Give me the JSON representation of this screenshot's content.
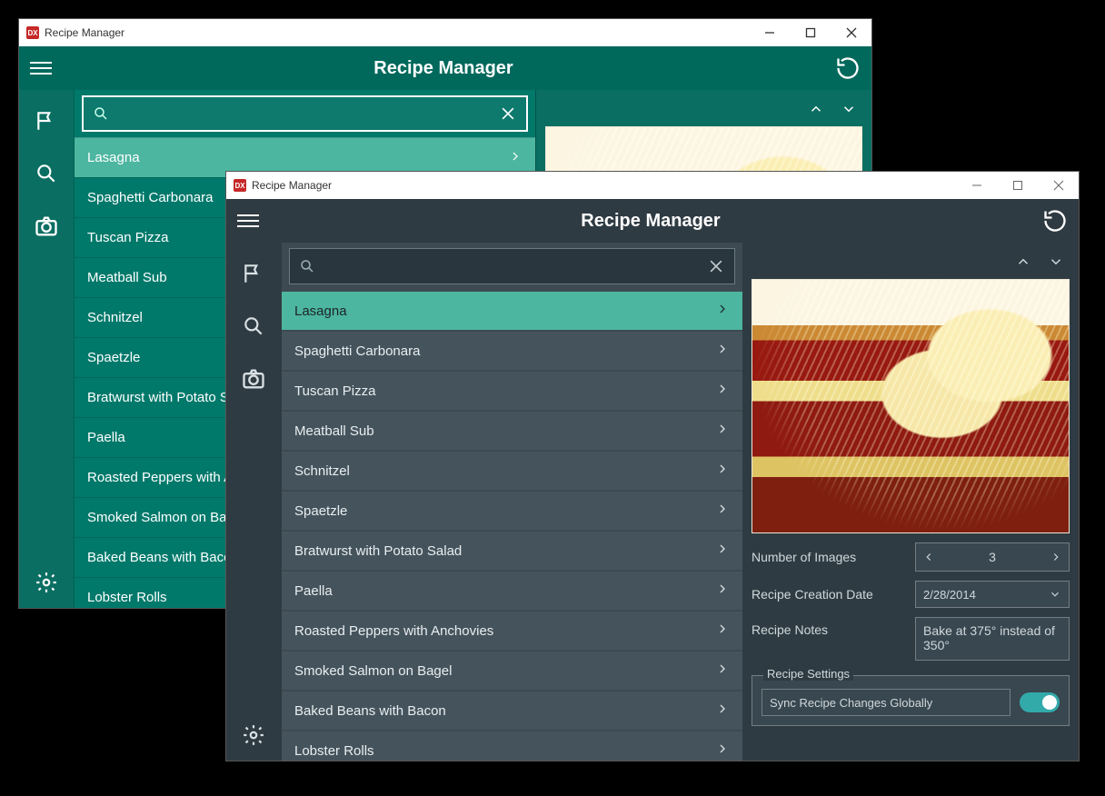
{
  "windows": {
    "teal": {
      "title": "Recipe Manager",
      "app_title": "Recipe Manager"
    },
    "dark": {
      "title": "Recipe Manager",
      "app_title": "Recipe Manager"
    }
  },
  "search": {
    "placeholder": ""
  },
  "recipes": [
    "Lasagna",
    "Spaghetti Carbonara",
    "Tuscan Pizza",
    "Meatball Sub",
    "Schnitzel",
    "Spaetzle",
    "Bratwurst with Potato Salad",
    "Paella",
    "Roasted Peppers with Anchovies",
    "Smoked Salmon on Bagel",
    "Baked Beans with Bacon",
    "Lobster Rolls"
  ],
  "detail": {
    "number_of_images_label": "Number of Images",
    "number_of_images": "3",
    "creation_date_label": "Recipe Creation Date",
    "creation_date": "2/28/2014",
    "notes_label": "Recipe Notes",
    "notes": "Bake at 375° instead of 350°",
    "settings_legend": "Recipe Settings",
    "sync_label": "Sync Recipe Changes Globally",
    "sync_on": true
  }
}
